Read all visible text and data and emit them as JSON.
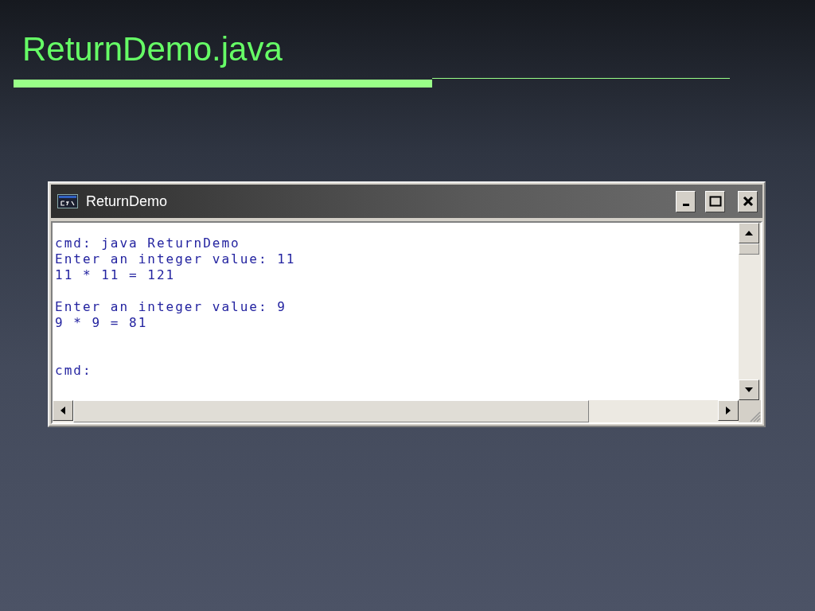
{
  "slide_title": "ReturnDemo.java",
  "window": {
    "title": "ReturnDemo"
  },
  "console": {
    "blocks": [
      [
        "cmd: java ReturnDemo",
        "Enter an integer value: 11",
        "11 * 11 = 121"
      ],
      [
        "Enter an integer value: 9",
        "9 * 9 = 81"
      ],
      [
        "cmd:"
      ]
    ]
  }
}
